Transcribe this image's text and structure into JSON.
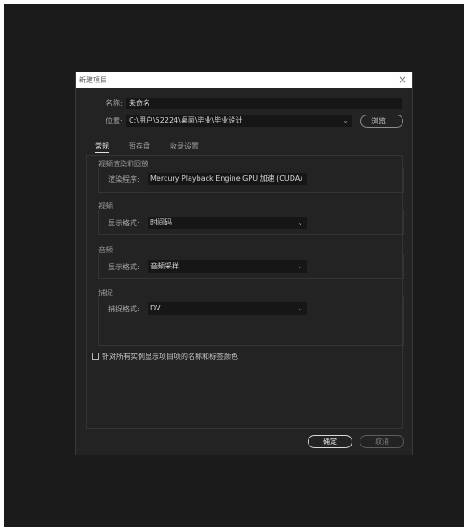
{
  "dialog": {
    "title": "新建项目",
    "close_glyph": "×",
    "name_label": "名称:",
    "name_value": "未命名",
    "location_label": "位置:",
    "location_value": "C:\\用户\\52224\\桌面\\毕业\\毕业设计",
    "browse_label": "浏览...",
    "tabs": [
      {
        "label": "常规",
        "active": true
      },
      {
        "label": "暂存盘",
        "active": false
      },
      {
        "label": "收录设置",
        "active": false
      }
    ],
    "groups": {
      "render": {
        "title": "视频渲染和回放",
        "field_label": "渲染程序:",
        "field_value": "Mercury Playback Engine GPU 加速 (CUDA)"
      },
      "video": {
        "title": "视频",
        "field_label": "显示格式:",
        "field_value": "时间码"
      },
      "audio": {
        "title": "音频",
        "field_label": "显示格式:",
        "field_value": "音频采样"
      },
      "capture": {
        "title": "捕捉",
        "field_label": "捕捉格式:",
        "field_value": "DV"
      }
    },
    "checkbox_label": "针对所有实例显示项目项的名称和标签颜色",
    "checkbox_checked": false,
    "ok_label": "确定",
    "cancel_label": "取消",
    "chevron_glyph": "⌄"
  },
  "colors": {
    "screen_bg": "#1b1b1b",
    "dialog_bg": "#232323",
    "field_bg": "#161616",
    "text": "#bdbdbd"
  }
}
